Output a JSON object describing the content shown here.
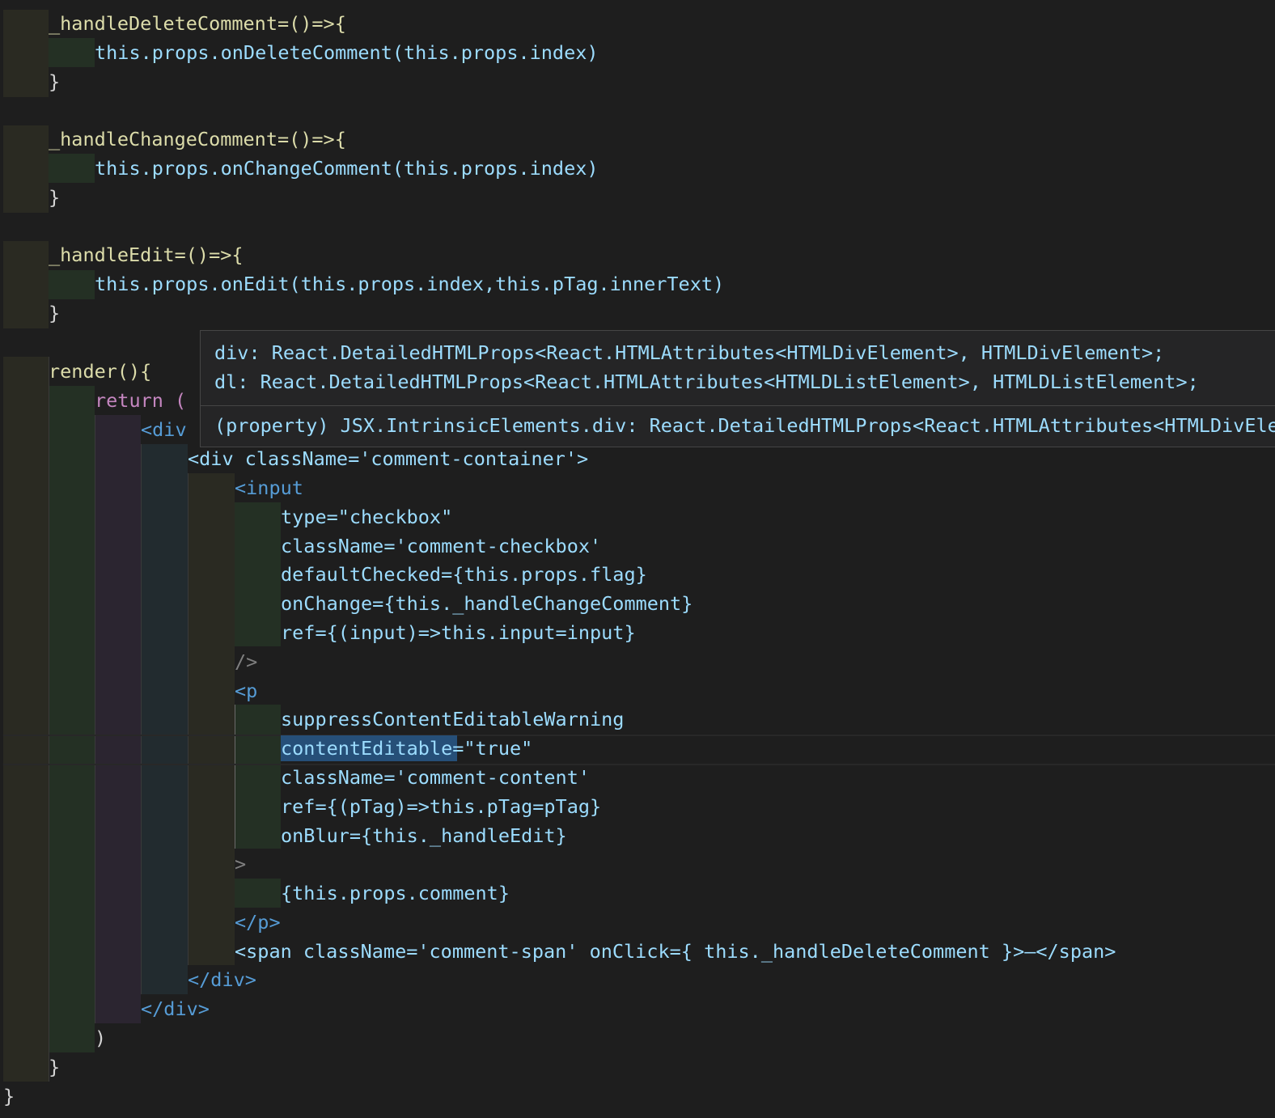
{
  "code": {
    "lines": [
      "_handleDeleteComment=()=>{",
      "this.props.onDeleteComment(this.props.index)",
      "}",
      "_handleChangeComment=()=>{",
      "this.props.onChangeComment(this.props.index)",
      "}",
      "_handleEdit=()=>{",
      "this.props.onEdit(this.props.index,this.pTag.innerText)",
      "}",
      "render(){",
      "return (",
      "<div",
      "<div className='comment-container'>",
      "<input",
      "type=\"checkbox\"",
      "className='comment-checkbox'",
      "defaultChecked={this.props.flag}",
      "onChange={this._handleChangeComment}",
      "ref={(input)=>this.input=input}",
      "/>",
      "<p",
      "suppressContentEditableWarning",
      "contentEditable=\"true\"",
      "className='comment-content'",
      "ref={(pTag)=>this.pTag=pTag}",
      "onBlur={this._handleEdit}",
      ">",
      "{this.props.comment}",
      "</p>",
      "<span className='comment-span' onClick={ this._handleDeleteComment }>—</span>",
      "</div>",
      "</div>",
      ")",
      "}",
      "}"
    ]
  },
  "hover": {
    "line1": "div: React.DetailedHTMLProps<React.HTMLAttributes<HTMLDivElement>, HTMLDivElement>;",
    "line2": "dl: React.DetailedHTMLProps<React.HTMLAttributes<HTMLDListElement>, HTMLDListElement>;",
    "line3": "(property) JSX.IntrinsicElements.div: React.DetailedHTMLProps<React.HTMLAttributes<HTMLDivElement>, HTMLDivElement>"
  },
  "colors": {
    "background": "#1e1e1e",
    "keyword": "#569cd6",
    "variable": "#9cdcfe",
    "function": "#dcdcaa",
    "string": "#ce9178",
    "control": "#c586c0",
    "selection": "#264f78"
  }
}
